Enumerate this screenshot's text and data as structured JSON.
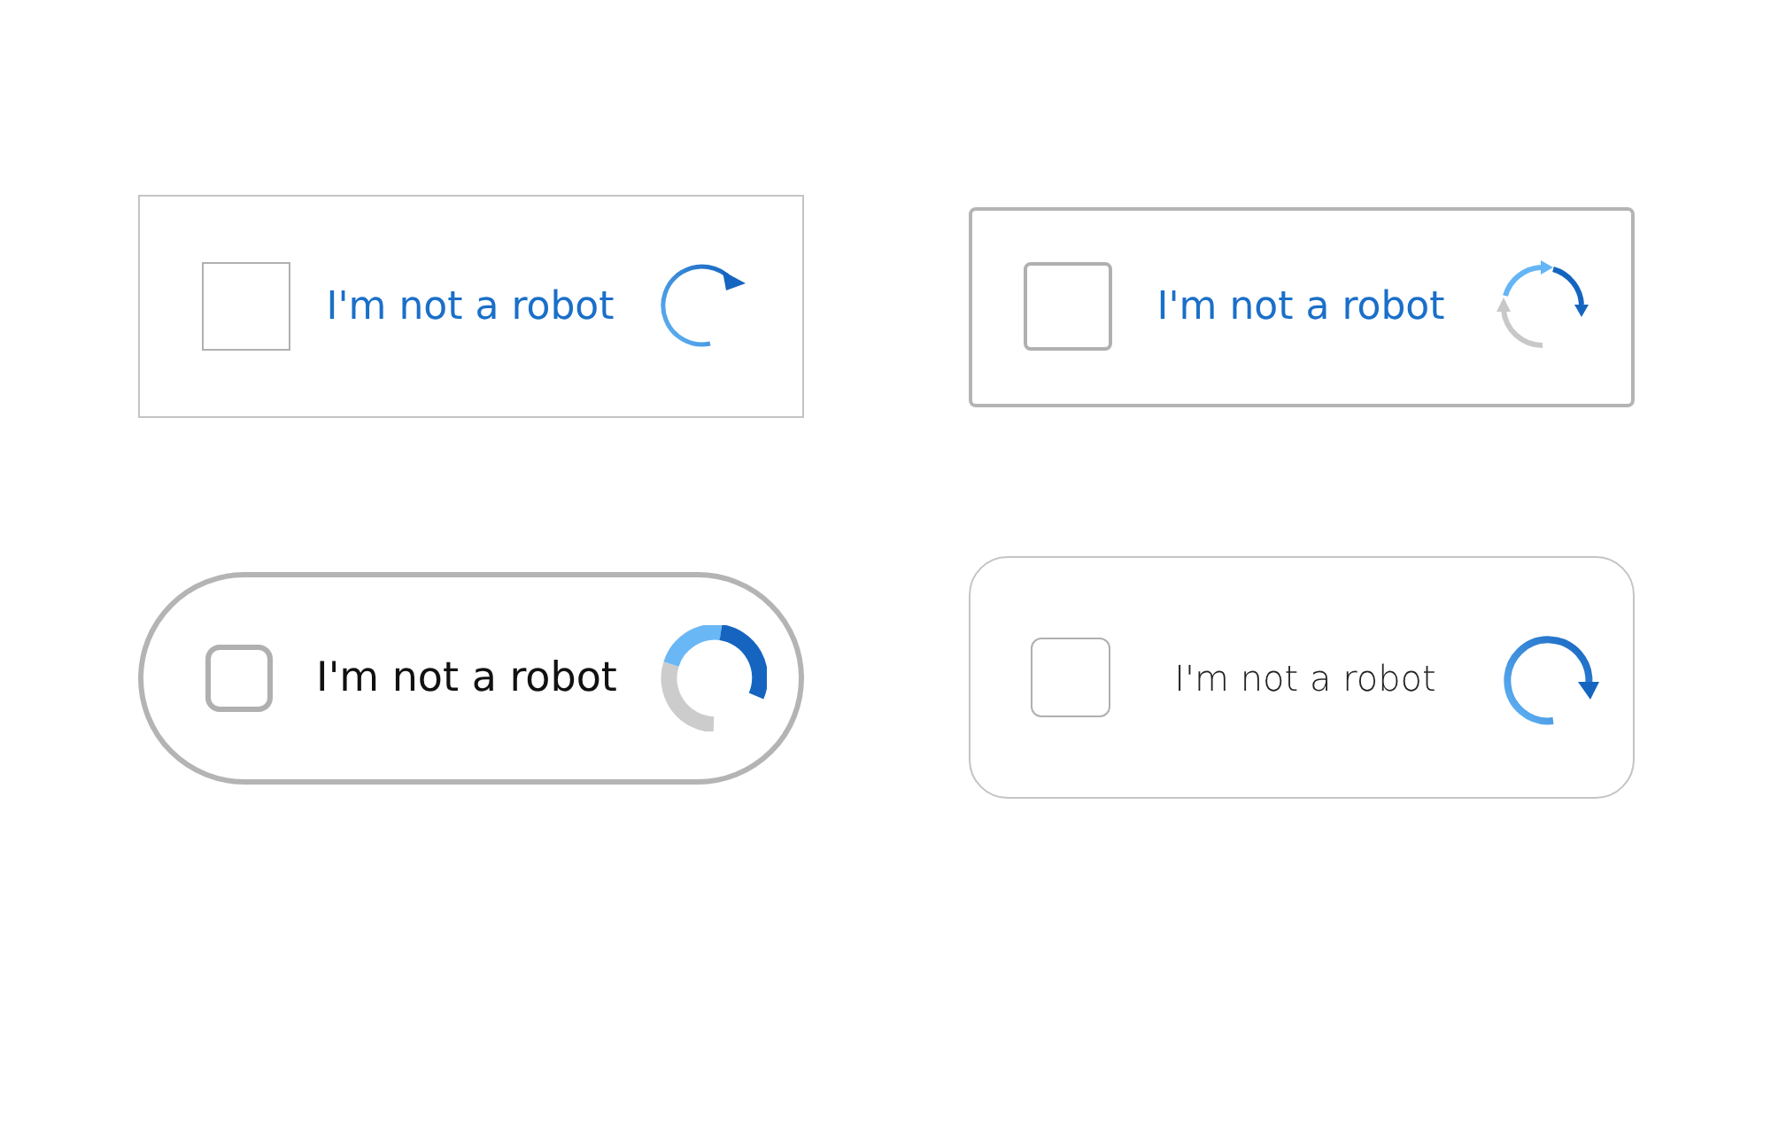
{
  "widgets": [
    {
      "kind": "square",
      "label": "I'm not a robot",
      "checked": false
    },
    {
      "kind": "rounded",
      "label": "I'm not a robot",
      "checked": false
    },
    {
      "kind": "pill",
      "label": "I'm not a robot",
      "checked": false
    },
    {
      "kind": "soft",
      "label": "I'm not a robot",
      "checked": false
    }
  ]
}
